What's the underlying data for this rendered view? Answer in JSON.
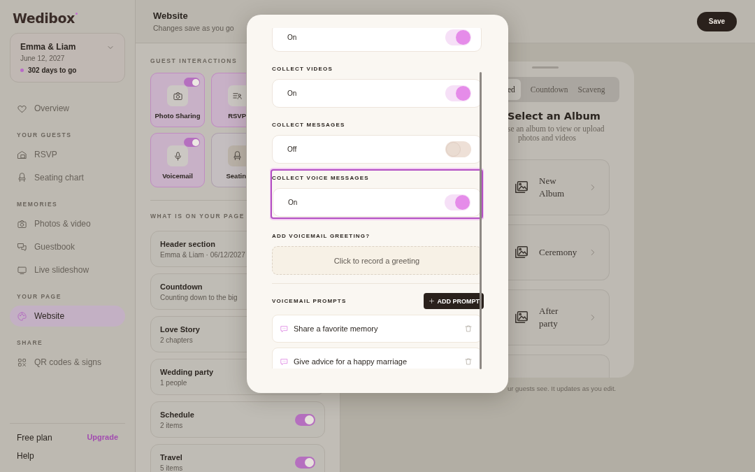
{
  "brand": {
    "name": "Wedibox"
  },
  "event": {
    "names": "Emma & Liam",
    "date": "June 12, 2027",
    "countdown": "302 days to go"
  },
  "sidebar": {
    "sections": [
      {
        "items": [
          {
            "label": "Overview",
            "selected": false
          }
        ]
      },
      {
        "heading": "YOUR GUESTS",
        "items": [
          {
            "label": "RSVP",
            "selected": false
          },
          {
            "label": "Seating chart",
            "selected": false
          }
        ]
      },
      {
        "heading": "MEMORIES",
        "items": [
          {
            "label": "Photos & video",
            "selected": false
          },
          {
            "label": "Guestbook",
            "selected": false
          },
          {
            "label": "Live slideshow",
            "selected": false
          }
        ]
      },
      {
        "heading": "YOUR PAGE",
        "items": [
          {
            "label": "Website",
            "selected": true
          }
        ]
      },
      {
        "heading": "SHARE",
        "items": [
          {
            "label": "QR codes & signs",
            "selected": false
          }
        ]
      }
    ],
    "footer": {
      "plan": "Free plan",
      "upgrade": "Upgrade",
      "help": "Help"
    }
  },
  "header": {
    "title": "Website",
    "subtitle": "Changes save as you go",
    "save": "Save"
  },
  "guest_interactions": {
    "heading": "GUEST INTERACTIONS",
    "tiles": [
      {
        "label": "Photo Sharing",
        "on": true
      },
      {
        "label": "RSVP",
        "on": true
      },
      {
        "label": "Voicemail",
        "on": true
      },
      {
        "label": "Seatin",
        "on": false
      }
    ]
  },
  "page_sections": {
    "heading": "WHAT IS ON YOUR PAGE",
    "items": [
      {
        "title": "Header section",
        "subtitle": "Emma & Liam · 06/12/2027"
      },
      {
        "title": "Countdown",
        "subtitle": "Counting down to the big"
      },
      {
        "title": "Love Story",
        "subtitle": "2 chapters"
      },
      {
        "title": "Wedding party",
        "subtitle": "1 people"
      },
      {
        "title": "Schedule",
        "subtitle": "2 items",
        "on": true
      },
      {
        "title": "Travel",
        "subtitle": "5 items",
        "on": true
      }
    ]
  },
  "preview": {
    "tabs": [
      {
        "label": "ed",
        "selected": true
      },
      {
        "label": "Countdown",
        "selected": false
      },
      {
        "label": "Scaveng",
        "selected": false
      }
    ],
    "title": "Select an Album",
    "subtitle_lines": [
      "se an album to view or upload",
      "photos and videos"
    ],
    "albums": [
      {
        "name": "New Album"
      },
      {
        "name": "Ceremony"
      },
      {
        "name": "After party"
      }
    ],
    "caption": "ur guests see. It updates as you edit."
  },
  "modal": {
    "settings": [
      {
        "value": "On",
        "on": true,
        "highlighted": false
      },
      {
        "label": "COLLECT VIDEOS",
        "value": "On",
        "on": true,
        "highlighted": false
      },
      {
        "label": "COLLECT MESSAGES",
        "value": "Off",
        "on": false,
        "highlighted": false
      },
      {
        "label": "COLLECT VOICE MESSAGES",
        "value": "On",
        "on": true,
        "highlighted": true
      }
    ],
    "greeting": {
      "label": "ADD VOICEMAIL GREETING?",
      "button": "Click to record a greeting"
    },
    "prompts": {
      "label": "VOICEMAIL PROMPTS",
      "add_button": "ADD PROMPT",
      "items": [
        "Share a favorite memory",
        "Give advice for a happy marriage"
      ]
    }
  }
}
